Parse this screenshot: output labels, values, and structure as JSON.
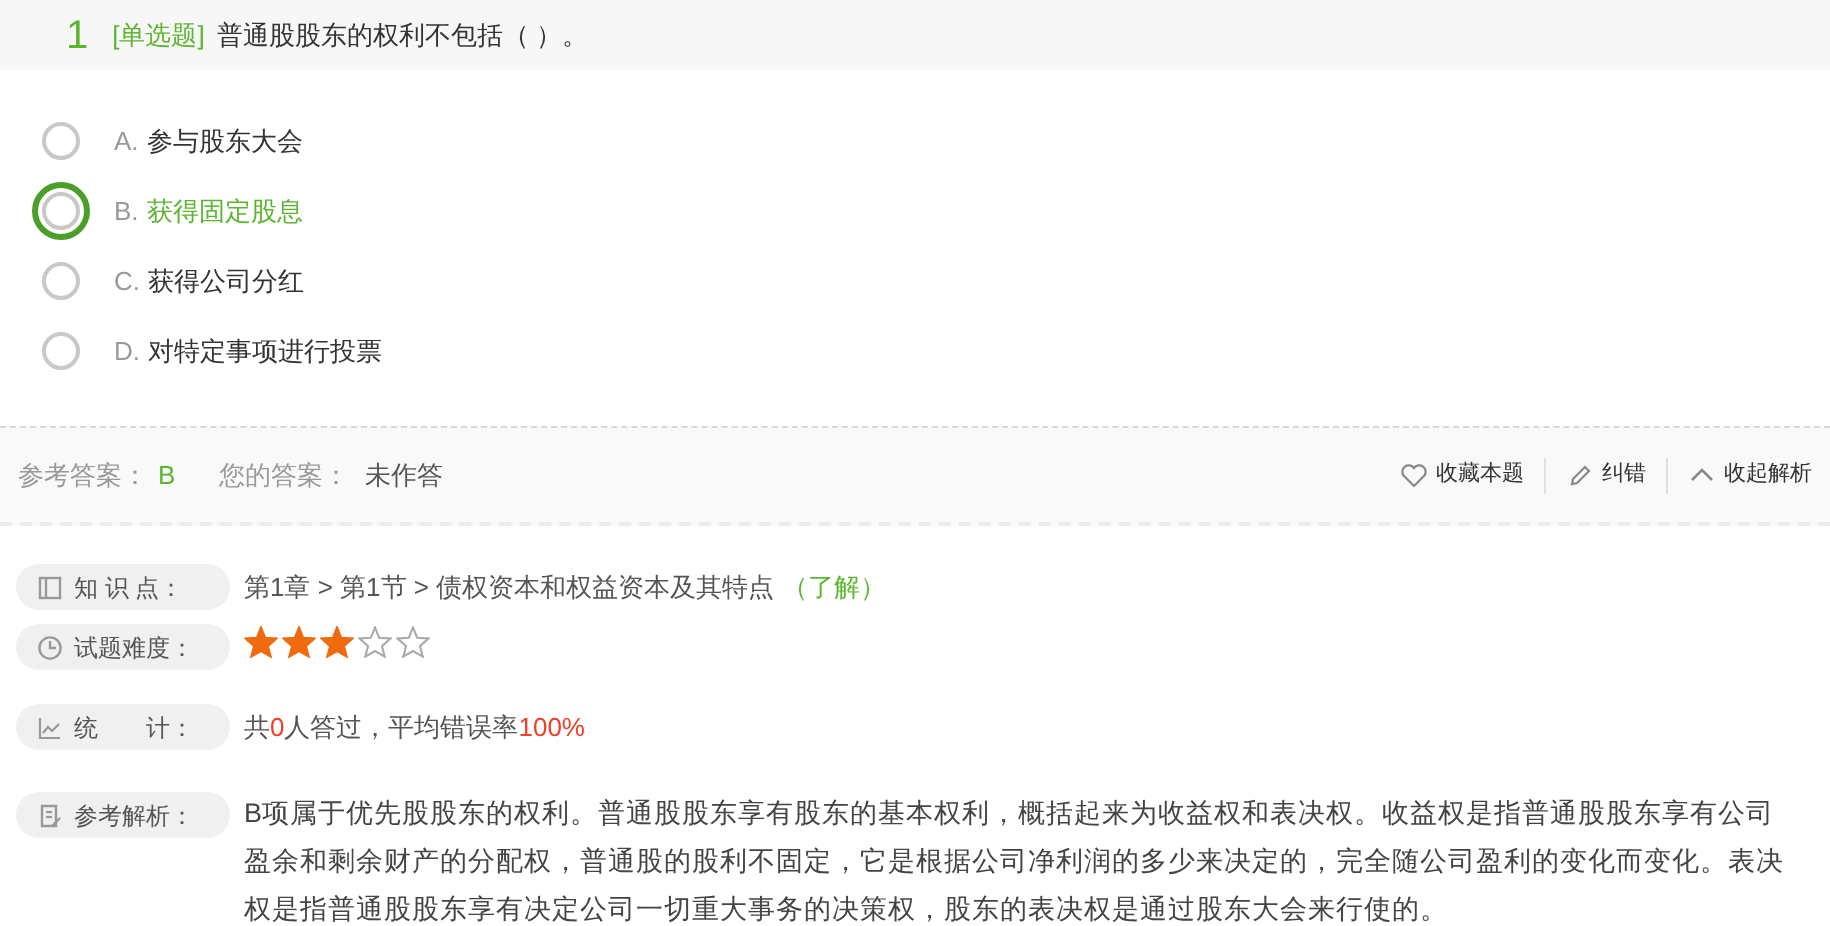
{
  "question": {
    "number": "1",
    "type": "[单选题]",
    "text": "普通股股东的权利不包括（ ）。"
  },
  "options": [
    {
      "letter": "A.",
      "text": "参与股东大会",
      "correct": false,
      "selected": false
    },
    {
      "letter": "B.",
      "text": "获得固定股息",
      "correct": true,
      "selected": false
    },
    {
      "letter": "C.",
      "text": "获得公司分红",
      "correct": false,
      "selected": false
    },
    {
      "letter": "D.",
      "text": "对特定事项进行投票",
      "correct": false,
      "selected": false
    }
  ],
  "answer_bar": {
    "reference_label": "参考答案：",
    "reference_answer": "B",
    "your_label": "您的答案：",
    "your_answer": "未作答",
    "actions": [
      {
        "kind": "favorite",
        "label": "收藏本题"
      },
      {
        "kind": "report",
        "label": "纠错"
      },
      {
        "kind": "collapse",
        "label": "收起解析"
      }
    ]
  },
  "details": [
    {
      "kind": "knowledge",
      "label": "知 识 点：",
      "text": "第1章 > 第1节 > 债权资本和权益资本及其特点",
      "tag": "（了解）"
    },
    {
      "kind": "difficulty",
      "label": "试题难度：",
      "stars": 3
    },
    {
      "kind": "stats",
      "label": "统　　计：",
      "segments": [
        {
          "text": "共",
          "highlight": false
        },
        {
          "text": "0",
          "highlight": true
        },
        {
          "text": "人答过，平均错误率",
          "highlight": false
        },
        {
          "text": "100%",
          "highlight": true
        }
      ]
    },
    {
      "kind": "analysis",
      "label": "参考解析：",
      "text": "B项属于优先股股东的权利。普通股股东享有股东的基本权利，概括起来为收益权和表决权。收益权是指普通股股东享有公司盈余和剩余财产的分配权，普通股的股利不固定，它是根据公司净利润的多少来决定的，完全随公司盈利的变化而变化。表决权是指普通股股东享有决定公司一切重大事务的决策权，股东的表决权是通过股东大会来行使的。"
    }
  ]
}
